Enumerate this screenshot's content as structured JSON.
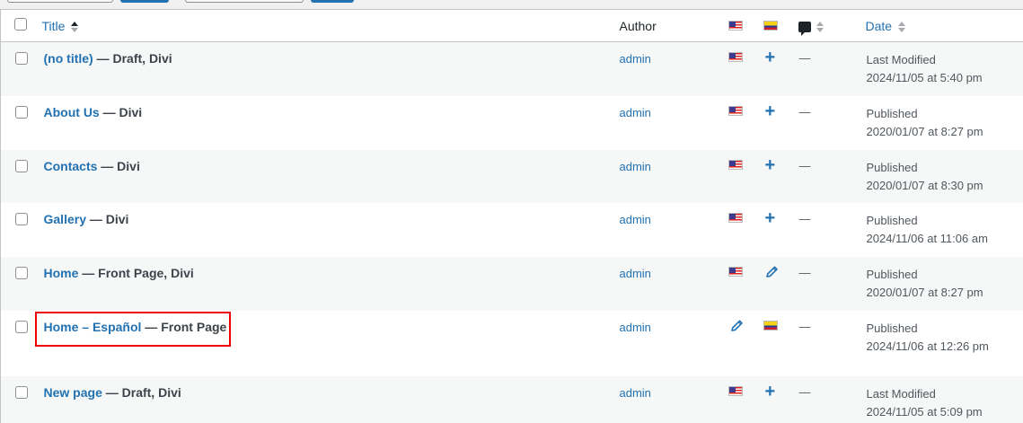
{
  "header": {
    "title": "Title",
    "author": "Author",
    "date": "Date",
    "flag_en": "us-flag-icon",
    "flag_es": "colombia-flag-icon",
    "comments_icon": "comment-bubble-icon"
  },
  "rows": [
    {
      "title": "(no title)",
      "state": " — Draft, Divi",
      "author": "admin",
      "en": "flag",
      "es": "plus",
      "comments": "—",
      "status": "Last Modified",
      "date": "2024/11/05 at 5:40 pm"
    },
    {
      "title": "About Us",
      "state": " — Divi",
      "author": "admin",
      "en": "flag",
      "es": "plus",
      "comments": "—",
      "status": "Published",
      "date": "2020/01/07 at 8:27 pm"
    },
    {
      "title": "Contacts",
      "state": " — Divi",
      "author": "admin",
      "en": "flag",
      "es": "plus",
      "comments": "—",
      "status": "Published",
      "date": "2020/01/07 at 8:30 pm"
    },
    {
      "title": "Gallery",
      "state": " — Divi",
      "author": "admin",
      "en": "flag",
      "es": "plus",
      "comments": "—",
      "status": "Published",
      "date": "2024/11/06 at 11:06 am"
    },
    {
      "title": "Home",
      "state": " — Front Page, Divi",
      "author": "admin",
      "en": "flag",
      "es": "pencil",
      "comments": "—",
      "status": "Published",
      "date": "2020/01/07 at 8:27 pm"
    },
    {
      "title": "Home – Español",
      "state": " — Front Page",
      "author": "admin",
      "en": "pencil",
      "es": "flag",
      "comments": "—",
      "status": "Published",
      "date": "2024/11/06 at 12:26 pm"
    },
    {
      "title": "New page",
      "state": " — Draft, Divi",
      "author": "admin",
      "en": "flag",
      "es": "plus",
      "comments": "—",
      "status": "Last Modified",
      "date": "2024/11/05 at 5:09 pm"
    }
  ],
  "colors": {
    "link": "#2271b1",
    "highlight": "#ee0000",
    "stripe": "#f6f7f7"
  }
}
